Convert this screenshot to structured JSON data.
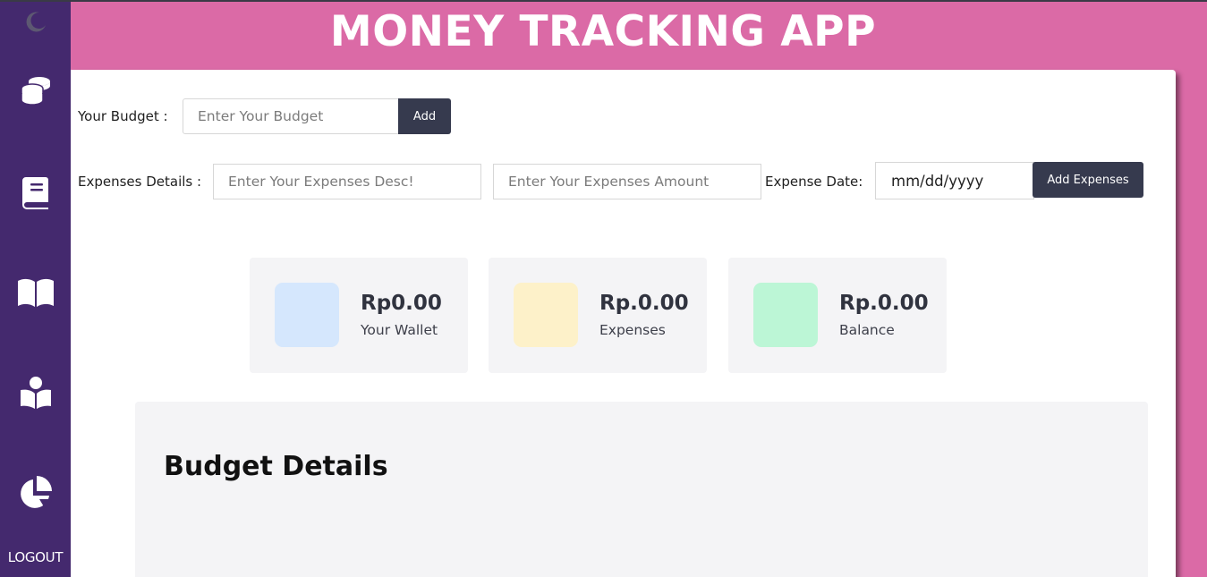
{
  "app": {
    "title": "MONEY TRACKING APP"
  },
  "sidebar": {
    "items": [
      {
        "icon": "moon-icon"
      },
      {
        "icon": "coins-icon"
      },
      {
        "icon": "book-icon"
      },
      {
        "icon": "book-open-icon"
      },
      {
        "icon": "book-reader-icon"
      },
      {
        "icon": "chart-pie-icon"
      }
    ],
    "logout_label": "LOGOUT"
  },
  "budget_form": {
    "label": "Your Budget :",
    "input_placeholder": "Enter Your Budget",
    "add_label": "Add"
  },
  "expense_form": {
    "label": "Expenses Details :",
    "desc_placeholder": "Enter Your Expenses Desc!",
    "amount_placeholder": "Enter Your Expenses Amount",
    "date_label": "Expense Date:",
    "date_value": "mm/dd/yyyy",
    "add_label": "Add Expenses"
  },
  "cards": [
    {
      "amount": "Rp0.00",
      "caption": "Your Wallet",
      "color": "#d5e7fd"
    },
    {
      "amount": "Rp.0.00",
      "caption": "Expenses",
      "color": "#fdf1c9"
    },
    {
      "amount": "Rp.0.00",
      "caption": "Balance",
      "color": "#bcf6d6"
    }
  ],
  "details": {
    "title": "Budget Details"
  },
  "colors": {
    "sidebar": "#44296e",
    "header": "#db6aa6",
    "button": "#363a4e",
    "card_bg": "#f4f4f6"
  }
}
